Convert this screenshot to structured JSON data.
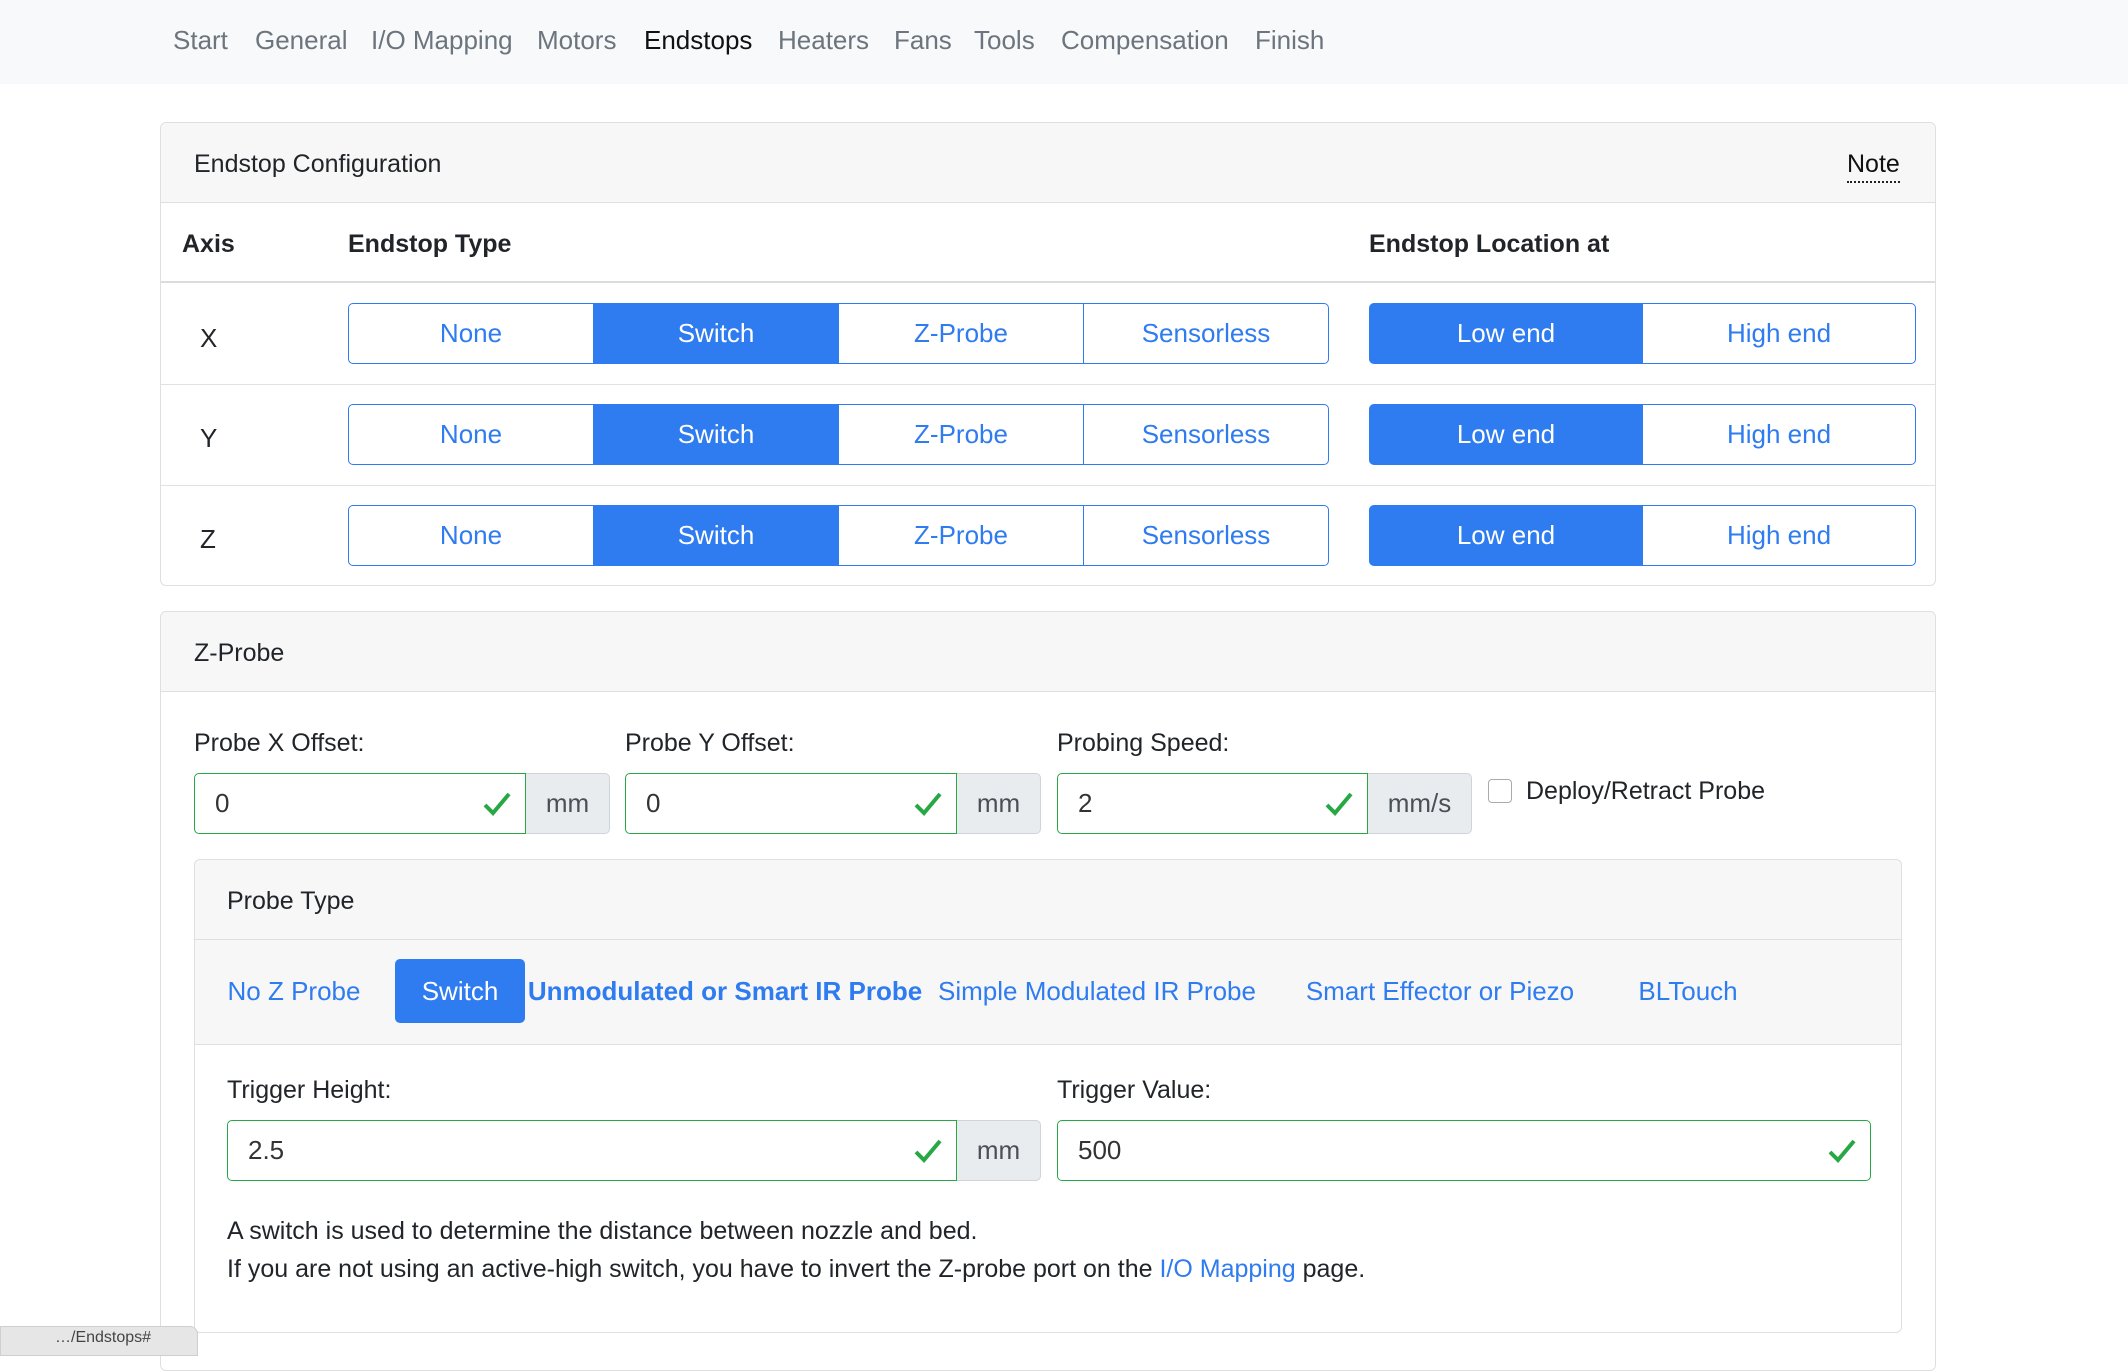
{
  "nav": {
    "items": [
      "Start",
      "General",
      "I/O Mapping",
      "Motors",
      "Endstops",
      "Heaters",
      "Fans",
      "Tools",
      "Compensation",
      "Finish"
    ],
    "active": "Endstops"
  },
  "endstop": {
    "title": "Endstop Configuration",
    "note": "Note",
    "headers": {
      "axis": "Axis",
      "type": "Endstop Type",
      "location": "Endstop Location at"
    },
    "type_options": [
      "None",
      "Switch",
      "Z-Probe",
      "Sensorless"
    ],
    "location_options": [
      "Low end",
      "High end"
    ],
    "rows": [
      {
        "axis": "X",
        "type": "Switch",
        "location": "Low end"
      },
      {
        "axis": "Y",
        "type": "Switch",
        "location": "Low end"
      },
      {
        "axis": "Z",
        "type": "Switch",
        "location": "Low end"
      }
    ]
  },
  "zprobe": {
    "title": "Z-Probe",
    "probe_x": {
      "label": "Probe X Offset:",
      "value": "0",
      "unit": "mm"
    },
    "probe_y": {
      "label": "Probe Y Offset:",
      "value": "0",
      "unit": "mm"
    },
    "speed": {
      "label": "Probing Speed:",
      "value": "2",
      "unit": "mm/s"
    },
    "deploy_label": "Deploy/Retract Probe",
    "deploy_checked": false,
    "probe_type": {
      "title": "Probe Type",
      "options": [
        "No Z Probe",
        "Switch",
        "Unmodulated or Smart IR Probe",
        "Simple Modulated IR Probe",
        "Smart Effector or Piezo",
        "BLTouch"
      ],
      "selected": "Switch"
    },
    "trigger_height": {
      "label": "Trigger Height:",
      "value": "2.5",
      "unit": "mm"
    },
    "trigger_value": {
      "label": "Trigger Value:",
      "value": "500"
    },
    "help_line1": "A switch is used to determine the distance between nozzle and bed.",
    "help_line2_pre": "If you are not using an active-high switch, you have to invert the Z-probe port on the ",
    "help_link": "I/O Mapping",
    "help_line2_post": " page."
  },
  "status_url": "…/Endstops#"
}
